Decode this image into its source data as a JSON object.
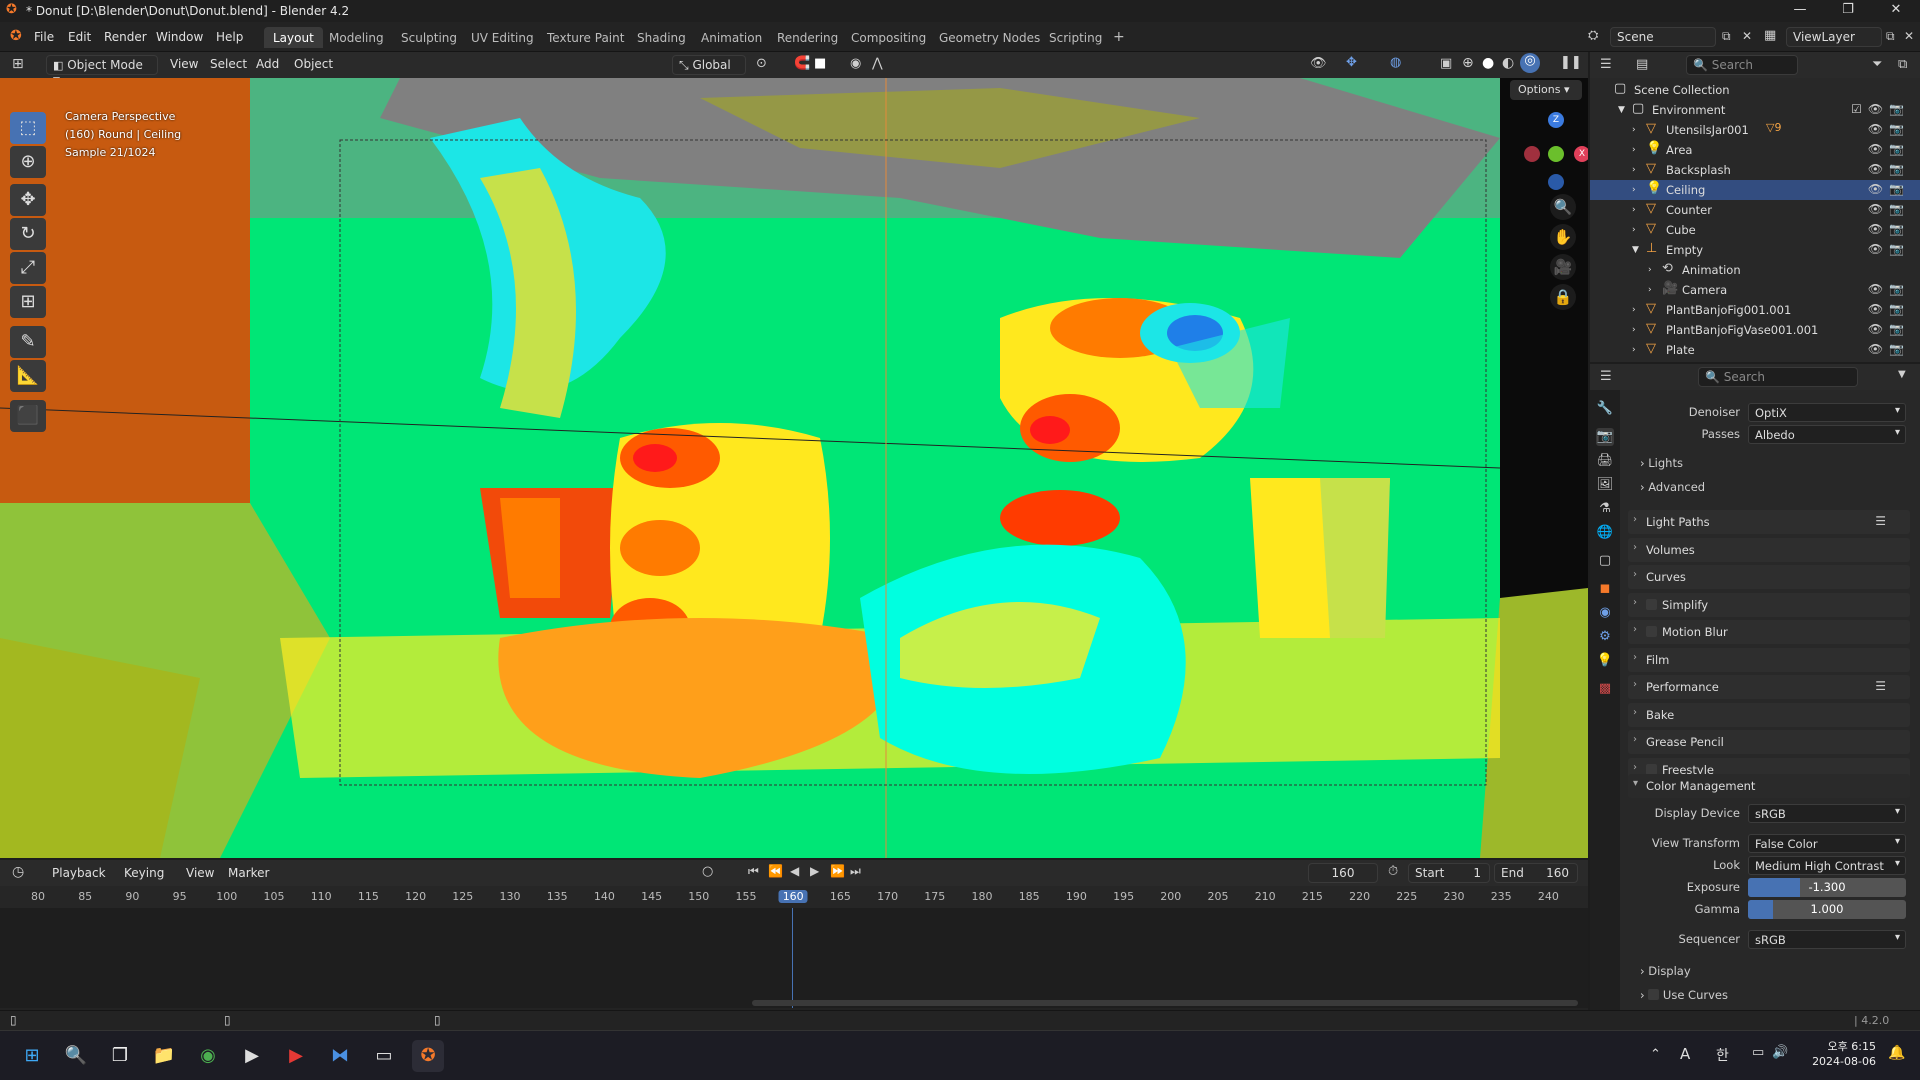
{
  "window": {
    "title": "* Donut [D:\\Blender\\Donut\\Donut.blend] - Blender 4.2",
    "minimize": "—",
    "maximize": "❐",
    "close": "✕"
  },
  "menu": [
    "File",
    "Edit",
    "Render",
    "Window",
    "Help"
  ],
  "workspaces": [
    "Layout",
    "Modeling",
    "Sculpting",
    "UV Editing",
    "Texture Paint",
    "Shading",
    "Animation",
    "Rendering",
    "Compositing",
    "Geometry Nodes",
    "Scripting"
  ],
  "workspace_add": "+",
  "active_workspace": "Layout",
  "scene": {
    "scene_label": "Scene",
    "viewlayer_label": "ViewLayer"
  },
  "viewport_header": {
    "mode": "Object Mode",
    "menus": [
      "View",
      "Select",
      "Add",
      "Object"
    ],
    "orientation": "Global",
    "options": "Options"
  },
  "viewport_overlay": {
    "line1": "Camera Perspective",
    "line2": "(160) Round | Ceiling",
    "line3": "Sample 21/1024"
  },
  "gizmo": {
    "x": "X",
    "y": "Y",
    "z": "Z"
  },
  "timeline": {
    "menus": [
      "Playback",
      "Keying",
      "View",
      "Marker"
    ],
    "current_frame": "160",
    "start_label": "Start",
    "start": "1",
    "end_label": "End",
    "end": "160",
    "ticks": [
      "80",
      "85",
      "90",
      "95",
      "100",
      "105",
      "110",
      "115",
      "120",
      "125",
      "130",
      "135",
      "140",
      "145",
      "150",
      "155",
      "160",
      "165",
      "170",
      "175",
      "180",
      "185",
      "190",
      "195",
      "200",
      "205",
      "210",
      "215",
      "220",
      "225",
      "230",
      "235",
      "240"
    ]
  },
  "outliner": {
    "search_placeholder": "Search",
    "root": "Scene Collection",
    "collection": "Environment",
    "items": [
      {
        "name": "UtensilsJar001",
        "indent": 2,
        "icon": "mesh-icon",
        "badge": "9"
      },
      {
        "name": "Area",
        "indent": 2,
        "icon": "light-icon"
      },
      {
        "name": "Backsplash",
        "indent": 2,
        "icon": "mesh-icon"
      },
      {
        "name": "Ceiling",
        "indent": 2,
        "icon": "light-icon",
        "selected": true
      },
      {
        "name": "Counter",
        "indent": 2,
        "icon": "mesh-icon"
      },
      {
        "name": "Cube",
        "indent": 2,
        "icon": "mesh-icon"
      },
      {
        "name": "Empty",
        "indent": 2,
        "icon": "empty-icon"
      },
      {
        "name": "Animation",
        "indent": 3,
        "icon": "action-icon"
      },
      {
        "name": "Camera",
        "indent": 3,
        "icon": "camera-icon"
      },
      {
        "name": "PlantBanjoFig001.001",
        "indent": 2,
        "icon": "mesh-icon"
      },
      {
        "name": "PlantBanjoFigVase001.001",
        "indent": 2,
        "icon": "mesh-icon"
      },
      {
        "name": "Plate",
        "indent": 2,
        "icon": "mesh-icon"
      }
    ]
  },
  "properties": {
    "search_placeholder": "Search",
    "denoiser_label": "Denoiser",
    "denoiser": "OptiX",
    "passes_label": "Passes",
    "passes": "Albedo",
    "sub_lights": "Lights",
    "sub_advanced": "Advanced",
    "sections": [
      "Light Paths",
      "Volumes",
      "Curves",
      "Simplify",
      "Motion Blur",
      "Film",
      "Performance",
      "Bake",
      "Grease Pencil",
      "Freestyle"
    ],
    "color_management": "Color Management",
    "display_device_label": "Display Device",
    "display_device": "sRGB",
    "view_transform_label": "View Transform",
    "view_transform": "False Color",
    "look_label": "Look",
    "look": "Medium High Contrast",
    "exposure_label": "Exposure",
    "exposure": "-1.300",
    "exposure_fill": 0.33,
    "gamma_label": "Gamma",
    "gamma": "1.000",
    "gamma_fill": 0.16,
    "sequencer_label": "Sequencer",
    "sequencer": "sRGB",
    "sub_display": "Display",
    "sub_use_curves": "Use Curves"
  },
  "status": {
    "version": "4.2.0"
  },
  "taskbar": {
    "ime": "A",
    "korean": "한",
    "time": "오후 6:15",
    "date": "2024-08-06"
  },
  "colors": {
    "accent": "#4772b3",
    "selection": "#334d80",
    "viewport_green": "#00e676"
  }
}
